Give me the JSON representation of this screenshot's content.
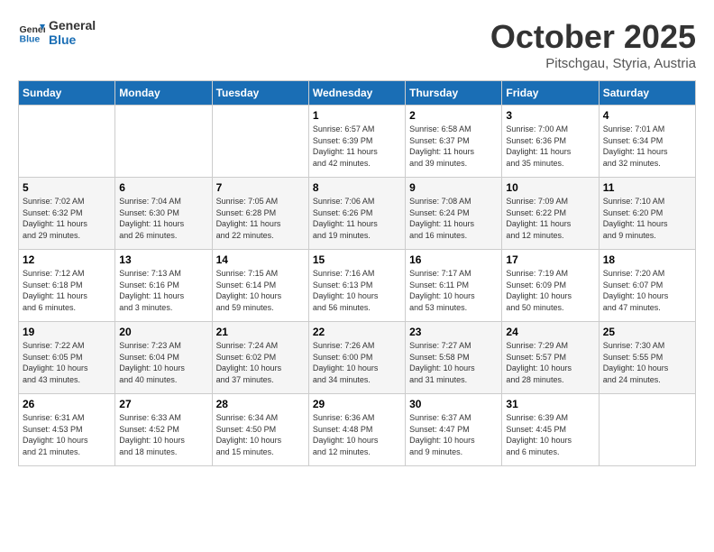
{
  "header": {
    "logo_line1": "General",
    "logo_line2": "Blue",
    "month": "October 2025",
    "location": "Pitschgau, Styria, Austria"
  },
  "weekdays": [
    "Sunday",
    "Monday",
    "Tuesday",
    "Wednesday",
    "Thursday",
    "Friday",
    "Saturday"
  ],
  "weeks": [
    [
      {
        "day": "",
        "info": ""
      },
      {
        "day": "",
        "info": ""
      },
      {
        "day": "",
        "info": ""
      },
      {
        "day": "1",
        "info": "Sunrise: 6:57 AM\nSunset: 6:39 PM\nDaylight: 11 hours\nand 42 minutes."
      },
      {
        "day": "2",
        "info": "Sunrise: 6:58 AM\nSunset: 6:37 PM\nDaylight: 11 hours\nand 39 minutes."
      },
      {
        "day": "3",
        "info": "Sunrise: 7:00 AM\nSunset: 6:36 PM\nDaylight: 11 hours\nand 35 minutes."
      },
      {
        "day": "4",
        "info": "Sunrise: 7:01 AM\nSunset: 6:34 PM\nDaylight: 11 hours\nand 32 minutes."
      }
    ],
    [
      {
        "day": "5",
        "info": "Sunrise: 7:02 AM\nSunset: 6:32 PM\nDaylight: 11 hours\nand 29 minutes."
      },
      {
        "day": "6",
        "info": "Sunrise: 7:04 AM\nSunset: 6:30 PM\nDaylight: 11 hours\nand 26 minutes."
      },
      {
        "day": "7",
        "info": "Sunrise: 7:05 AM\nSunset: 6:28 PM\nDaylight: 11 hours\nand 22 minutes."
      },
      {
        "day": "8",
        "info": "Sunrise: 7:06 AM\nSunset: 6:26 PM\nDaylight: 11 hours\nand 19 minutes."
      },
      {
        "day": "9",
        "info": "Sunrise: 7:08 AM\nSunset: 6:24 PM\nDaylight: 11 hours\nand 16 minutes."
      },
      {
        "day": "10",
        "info": "Sunrise: 7:09 AM\nSunset: 6:22 PM\nDaylight: 11 hours\nand 12 minutes."
      },
      {
        "day": "11",
        "info": "Sunrise: 7:10 AM\nSunset: 6:20 PM\nDaylight: 11 hours\nand 9 minutes."
      }
    ],
    [
      {
        "day": "12",
        "info": "Sunrise: 7:12 AM\nSunset: 6:18 PM\nDaylight: 11 hours\nand 6 minutes."
      },
      {
        "day": "13",
        "info": "Sunrise: 7:13 AM\nSunset: 6:16 PM\nDaylight: 11 hours\nand 3 minutes."
      },
      {
        "day": "14",
        "info": "Sunrise: 7:15 AM\nSunset: 6:14 PM\nDaylight: 10 hours\nand 59 minutes."
      },
      {
        "day": "15",
        "info": "Sunrise: 7:16 AM\nSunset: 6:13 PM\nDaylight: 10 hours\nand 56 minutes."
      },
      {
        "day": "16",
        "info": "Sunrise: 7:17 AM\nSunset: 6:11 PM\nDaylight: 10 hours\nand 53 minutes."
      },
      {
        "day": "17",
        "info": "Sunrise: 7:19 AM\nSunset: 6:09 PM\nDaylight: 10 hours\nand 50 minutes."
      },
      {
        "day": "18",
        "info": "Sunrise: 7:20 AM\nSunset: 6:07 PM\nDaylight: 10 hours\nand 47 minutes."
      }
    ],
    [
      {
        "day": "19",
        "info": "Sunrise: 7:22 AM\nSunset: 6:05 PM\nDaylight: 10 hours\nand 43 minutes."
      },
      {
        "day": "20",
        "info": "Sunrise: 7:23 AM\nSunset: 6:04 PM\nDaylight: 10 hours\nand 40 minutes."
      },
      {
        "day": "21",
        "info": "Sunrise: 7:24 AM\nSunset: 6:02 PM\nDaylight: 10 hours\nand 37 minutes."
      },
      {
        "day": "22",
        "info": "Sunrise: 7:26 AM\nSunset: 6:00 PM\nDaylight: 10 hours\nand 34 minutes."
      },
      {
        "day": "23",
        "info": "Sunrise: 7:27 AM\nSunset: 5:58 PM\nDaylight: 10 hours\nand 31 minutes."
      },
      {
        "day": "24",
        "info": "Sunrise: 7:29 AM\nSunset: 5:57 PM\nDaylight: 10 hours\nand 28 minutes."
      },
      {
        "day": "25",
        "info": "Sunrise: 7:30 AM\nSunset: 5:55 PM\nDaylight: 10 hours\nand 24 minutes."
      }
    ],
    [
      {
        "day": "26",
        "info": "Sunrise: 6:31 AM\nSunset: 4:53 PM\nDaylight: 10 hours\nand 21 minutes."
      },
      {
        "day": "27",
        "info": "Sunrise: 6:33 AM\nSunset: 4:52 PM\nDaylight: 10 hours\nand 18 minutes."
      },
      {
        "day": "28",
        "info": "Sunrise: 6:34 AM\nSunset: 4:50 PM\nDaylight: 10 hours\nand 15 minutes."
      },
      {
        "day": "29",
        "info": "Sunrise: 6:36 AM\nSunset: 4:48 PM\nDaylight: 10 hours\nand 12 minutes."
      },
      {
        "day": "30",
        "info": "Sunrise: 6:37 AM\nSunset: 4:47 PM\nDaylight: 10 hours\nand 9 minutes."
      },
      {
        "day": "31",
        "info": "Sunrise: 6:39 AM\nSunset: 4:45 PM\nDaylight: 10 hours\nand 6 minutes."
      },
      {
        "day": "",
        "info": ""
      }
    ]
  ]
}
